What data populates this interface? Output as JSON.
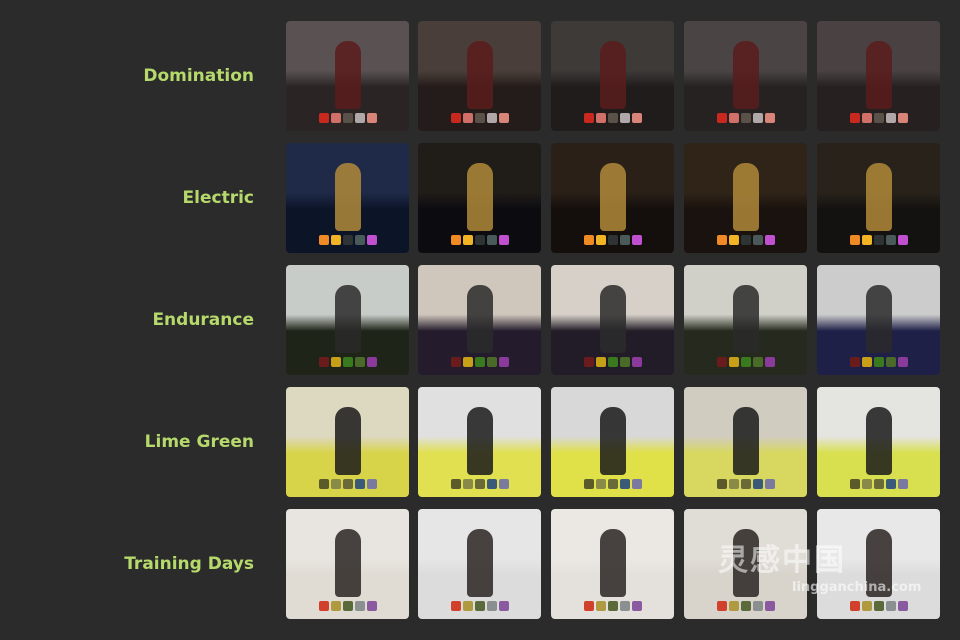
{
  "presets": [
    {
      "label": "Domination",
      "backgrounds": [
        "#2a2424",
        "#241c1a",
        "#201c1c",
        "#262222",
        "#262020"
      ],
      "tops": [
        "#5a5252",
        "#4a3e3a",
        "#3e3a38",
        "#4a4444",
        "#4a4242"
      ],
      "figure": "#5a1c1c",
      "swatches": [
        "#c8281e",
        "#d07068",
        "#5a5248",
        "#b0a8a8",
        "#d88478"
      ]
    },
    {
      "label": "Electric",
      "backgrounds": [
        "#0c1428",
        "#0c0c10",
        "#140e0c",
        "#1a120e",
        "#141210"
      ],
      "tops": [
        "#1e2a48",
        "#201c18",
        "#2a2018",
        "#302418",
        "#28221a"
      ],
      "figure": "#b08a3a",
      "swatches": [
        "#f08a24",
        "#f0b424",
        "#2e3434",
        "#4a5a5a",
        "#c050d0"
      ]
    },
    {
      "label": "Endurance",
      "backgrounds": [
        "#1e2418",
        "#241c2c",
        "#221c28",
        "#262a1e",
        "#1e2048"
      ],
      "tops": [
        "#c8ccc8",
        "#cfc6bc",
        "#d6d0c8",
        "#d0d0c8",
        "#cccccc"
      ],
      "figure": "#2a2a2a",
      "swatches": [
        "#6a1c1c",
        "#c8a018",
        "#3a7a1e",
        "#4a6a2a",
        "#8a3a9a"
      ]
    },
    {
      "label": "Lime Green",
      "backgrounds": [
        "#d8d44a",
        "#e0e050",
        "#e0e048",
        "#d8d860",
        "#d8e050"
      ],
      "tops": [
        "#ddd8c0",
        "#e0e0e0",
        "#d8d8d8",
        "#d0ccc0",
        "#e4e4e0"
      ],
      "figure": "#1a1a1a",
      "swatches": [
        "#5a5a2a",
        "#8a8a48",
        "#6a6a38",
        "#3a5a7a",
        "#7a7aa0"
      ]
    },
    {
      "label": "Training Days",
      "backgrounds": [
        "#e0dcd4",
        "#dcdcdc",
        "#e4e0dc",
        "#d8d4cc",
        "#dcdcdc"
      ],
      "tops": [
        "#e8e4e0",
        "#e6e6e6",
        "#ebe8e4",
        "#e0dcd6",
        "#e8e8e8"
      ],
      "figure": "#2a2422",
      "swatches": [
        "#d0402a",
        "#b09a40",
        "#5a6a3a",
        "#8a9090",
        "#8a5aa0"
      ]
    }
  ],
  "watermark": {
    "logo_text": "灵感中国",
    "url_text": "lingganchina.com"
  }
}
